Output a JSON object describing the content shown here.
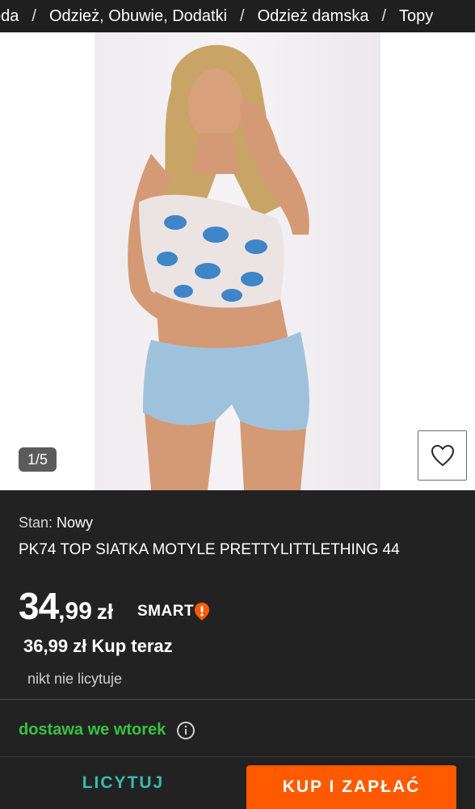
{
  "breadcrumb": {
    "items": [
      "oda",
      "Odzież, Obuwie, Dodatki",
      "Odzież damska",
      "Topy"
    ],
    "separator": "/"
  },
  "gallery": {
    "counter": "1/5",
    "favorite_icon": "heart-icon"
  },
  "product": {
    "condition_label": "Stan:",
    "condition_value": "Nowy",
    "title": "PK74 TOP SIATKA MOTYLE PRETTYLITTLETHING 44",
    "price_int": "34",
    "price_dec": ",99",
    "price_currency": "zł",
    "smart_label": "SMART",
    "buy_now_text": "36,99 zł Kup teraz",
    "bids_text": "nikt nie licytuje"
  },
  "delivery": {
    "text": "dostawa we wtorek",
    "info_icon": "info-icon"
  },
  "actions": {
    "bid_label": "LICYTUJ",
    "buy_label": "KUP I ZAPŁAĆ"
  },
  "colors": {
    "accent_orange": "#ff5a00",
    "bid_teal": "#35bdb1",
    "delivery_green": "#37c23f",
    "background": "#222222"
  }
}
